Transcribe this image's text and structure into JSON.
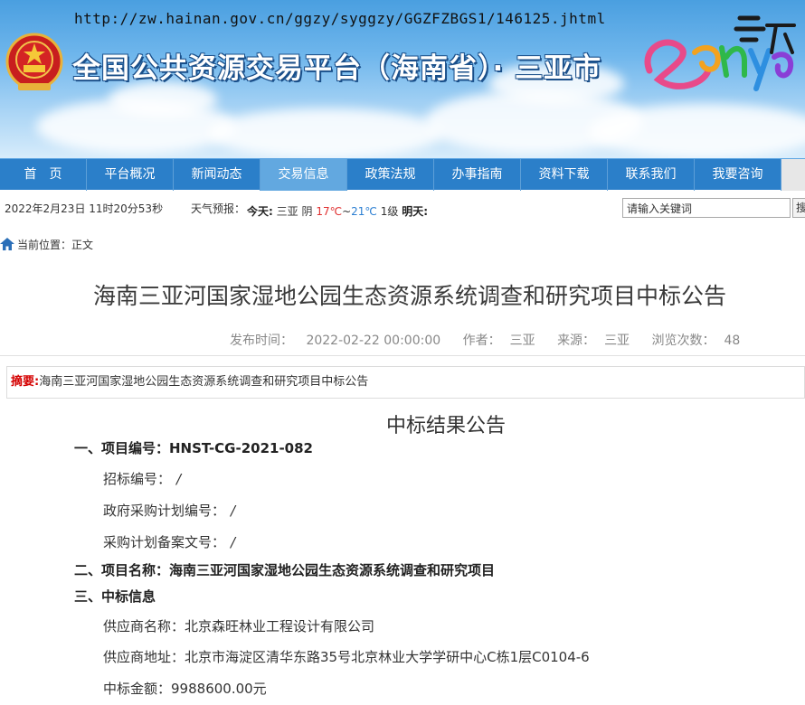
{
  "header": {
    "url": "http://zw.hainan.gov.cn/ggzy/syggzy/GGZFZBGS1/146125.jhtml",
    "site_title": "全国公共资源交易平台（海南省）· 三亚市",
    "logo_text": "Sanya 三亚"
  },
  "nav": {
    "items": [
      {
        "label": "首　页"
      },
      {
        "label": "平台概况"
      },
      {
        "label": "新闻动态"
      },
      {
        "label": "交易信息"
      },
      {
        "label": "政策法规"
      },
      {
        "label": "办事指南"
      },
      {
        "label": "资料下载"
      },
      {
        "label": "联系我们"
      },
      {
        "label": "我要咨询"
      }
    ],
    "active_index": 3,
    "colors": {
      "bar": "#2b7fc9",
      "active": "#62a8e0"
    }
  },
  "info_bar": {
    "datetime": "2022年2月23日 11时20分53秒",
    "weather_label": "天气预报：",
    "today_label": "今天:",
    "city": "三亚",
    "condition": "阴",
    "temp_high": "17℃",
    "temp_sep": "~",
    "temp_low": "21℃",
    "wind": "1级",
    "tomorrow_label": "明天:",
    "search_placeholder": "请输入关键词",
    "search_button": "搜"
  },
  "breadcrumb": {
    "label": "当前位置：",
    "current": "正文"
  },
  "article": {
    "title": "海南三亚河国家湿地公园生态资源系统调查和研究项目中标公告",
    "meta": {
      "publish_label": "发布时间：",
      "publish_time": "2022-02-22 00:00:00",
      "author_label": "作者：",
      "author": "三亚",
      "source_label": "来源：",
      "source": "三亚",
      "views_label": "浏览次数：",
      "views": "48"
    },
    "summary_label": "摘要:",
    "summary": "海南三亚河国家湿地公园生态资源系统调查和研究项目中标公告",
    "content_title": "中标结果公告",
    "section1": "一、项目编号：HNST-CG-2021-082",
    "bid_no_label": "招标编号：",
    "bid_no": "/",
    "gov_plan_label": "政府采购计划编号：",
    "gov_plan": "/",
    "plan_record_label": "采购计划备案文号：",
    "plan_record": "/",
    "section2": "二、项目名称：海南三亚河国家湿地公园生态资源系统调查和研究项目",
    "section3": "三、中标信息",
    "supplier_name_label": "供应商名称：",
    "supplier_name": "北京森旺林业工程设计有限公司",
    "supplier_addr_label": "供应商地址：",
    "supplier_addr": "北京市海淀区清华东路35号北京林业大学学研中心C栋1层C0104-6",
    "amount_label": "中标金额：",
    "amount": "9988600.00元"
  }
}
